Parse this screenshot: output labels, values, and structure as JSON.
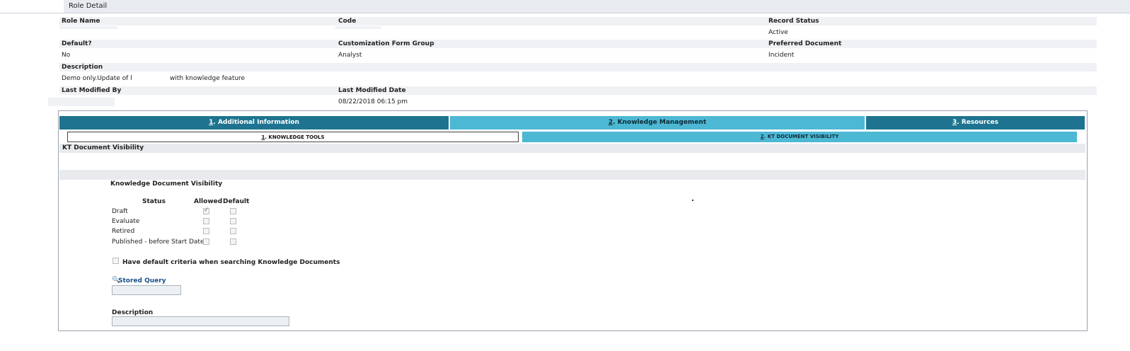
{
  "header": {
    "title": "Role Detail"
  },
  "fields": {
    "role_name_label": "Role Name",
    "code_label": "Code",
    "record_status_label": "Record Status",
    "record_status_value": "Active",
    "default_label": "Default?",
    "default_value": "No",
    "customization_label": "Customization Form Group",
    "customization_value": "Analyst",
    "preferred_doc_label": "Preferred Document",
    "preferred_doc_value": "Incident",
    "description_label": "Description",
    "description_value_prefix": "Demo only.Update of l",
    "description_value_suffix": "with knowledge feature",
    "last_modified_by_label": "Last Modified By",
    "last_modified_date_label": "Last Modified Date",
    "last_modified_date_value": "08/22/2018 06:15 pm"
  },
  "tabs": [
    {
      "num": "1",
      "label": ". Additional Information",
      "color": "#1e7490"
    },
    {
      "num": "2",
      "label": ". Knowledge Management",
      "color": "#4db8d4"
    },
    {
      "num": "3",
      "label": ". Resources",
      "color": "#1e7490"
    }
  ],
  "subtabs": [
    {
      "num": "1",
      "label": ". KNOWLEDGE TOOLS"
    },
    {
      "num": "2",
      "label": ". KT DOCUMENT VISIBILITY",
      "color": "#4db8d4"
    }
  ],
  "section": {
    "title": "KT Document Visibility",
    "group_title": "Knowledge Document Visibility",
    "col_status": "Status",
    "col_allowed": "Allowed",
    "col_default": "Default",
    "rows": [
      {
        "status": "Draft",
        "allowed": true,
        "default": false
      },
      {
        "status": "Evaluate",
        "allowed": false,
        "default": false
      },
      {
        "status": "Retired",
        "allowed": false,
        "default": false
      },
      {
        "status": "Published - before Start Date",
        "allowed": false,
        "default": false
      }
    ],
    "criteria_label": "Have default criteria when searching Knowledge Documents",
    "stored_query_label": "Stored Query",
    "description_label": "Description"
  }
}
